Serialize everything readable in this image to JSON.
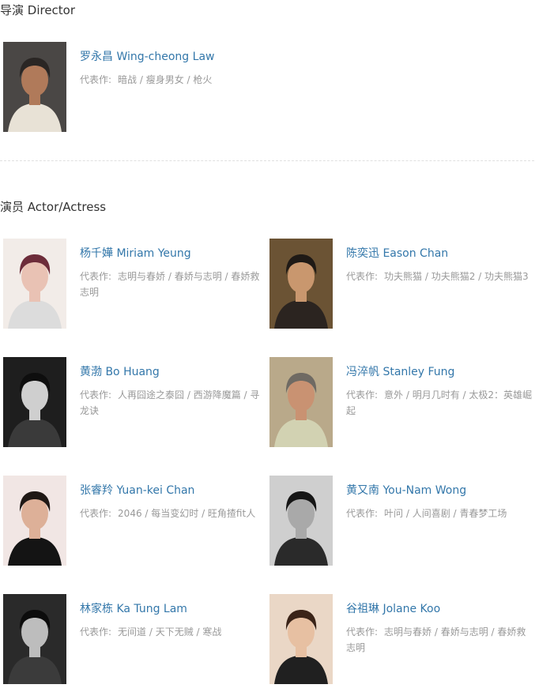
{
  "director_section": {
    "title": "导演 Director",
    "people": [
      {
        "name": "罗永昌 Wing-cheong Law",
        "works_label": "代表作:",
        "works": "暗战 / 瘦身男女 / 枪火",
        "photo_icon": "director-portrait",
        "photo_colors": {
          "bg": "#4a4745",
          "skin": "#b07a5a",
          "hair": "#2a2624",
          "shirt": "#e8e2d6"
        }
      }
    ]
  },
  "actor_section": {
    "title": "演员 Actor/Actress",
    "people": [
      {
        "name": "杨千嬅 Miriam Yeung",
        "works_label": "代表作:",
        "works": "志明与春娇 / 春娇与志明 / 春娇救志明",
        "photo_icon": "actor-portrait",
        "photo_colors": {
          "bg": "#f2ece8",
          "skin": "#e9c2b4",
          "hair": "#6d2c3a",
          "shirt": "#dcdcdc"
        }
      },
      {
        "name": "陈奕迅 Eason Chan",
        "works_label": "代表作:",
        "works": "功夫熊猫 / 功夫熊猫2 / 功夫熊猫3",
        "photo_icon": "actor-portrait",
        "photo_colors": {
          "bg": "#6b5334",
          "skin": "#c9976e",
          "hair": "#1f1a16",
          "shirt": "#2b2420"
        }
      },
      {
        "name": "黄渤 Bo Huang",
        "works_label": "代表作:",
        "works": "人再囧途之泰囧 / 西游降魔篇 / 寻龙诀",
        "photo_icon": "actor-portrait",
        "photo_colors": {
          "bg": "#1e1e1e",
          "skin": "#cfcfcf",
          "hair": "#0e0e0e",
          "shirt": "#3a3a3a"
        }
      },
      {
        "name": "冯淬帆 Stanley Fung",
        "works_label": "代表作:",
        "works": "意外 / 明月几时有 / 太极2：英雄崛起",
        "photo_icon": "actor-portrait",
        "photo_colors": {
          "bg": "#b9a98a",
          "skin": "#c99272",
          "hair": "#6f6a63",
          "shirt": "#d2d2b2"
        }
      },
      {
        "name": "张睿羚 Yuan-kei Chan",
        "works_label": "代表作:",
        "works": "2046 / 每当变幻时 / 旺角揸fit人",
        "photo_icon": "actor-portrait",
        "photo_colors": {
          "bg": "#f1e6e4",
          "skin": "#ddb098",
          "hair": "#1f1815",
          "shirt": "#141414"
        }
      },
      {
        "name": "黄又南 You-Nam Wong",
        "works_label": "代表作:",
        "works": "叶问 / 人间喜剧 / 青春梦工场",
        "photo_icon": "actor-portrait",
        "photo_colors": {
          "bg": "#cfcfcf",
          "skin": "#a9a9a9",
          "hair": "#161616",
          "shirt": "#2a2a2a"
        }
      },
      {
        "name": "林家栋 Ka Tung Lam",
        "works_label": "代表作:",
        "works": "无间道 / 天下无贼 / 寒战",
        "photo_icon": "actor-portrait",
        "photo_colors": {
          "bg": "#2a2a2a",
          "skin": "#bdbdbd",
          "hair": "#0c0c0c",
          "shirt": "#3b3b3b"
        }
      },
      {
        "name": "谷祖琳 Jolane Koo",
        "works_label": "代表作:",
        "works": "志明与春娇 / 春娇与志明 / 春娇救志明",
        "photo_icon": "actor-portrait",
        "photo_colors": {
          "bg": "#ead7c6",
          "skin": "#e7c0a2",
          "hair": "#3b2418",
          "shirt": "#202020"
        }
      }
    ]
  },
  "colors": {
    "link": "#3377aa",
    "muted": "#999999",
    "heading": "#333333",
    "divider": "#e0e0e0"
  }
}
